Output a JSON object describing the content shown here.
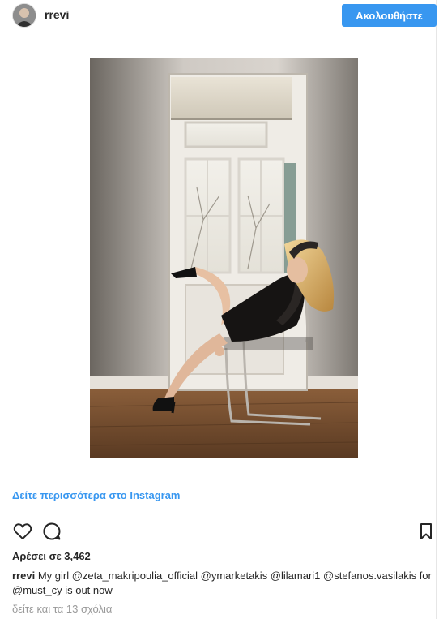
{
  "post": {
    "username": "rrevi",
    "follow_label": "Ακολουθήστε",
    "see_more": "Δείτε περισσότερα στο Instagram",
    "likes_text": "Αρέσει σε 3,462",
    "caption_user": "rrevi",
    "caption_text": "My girl @zeta_makripoulia_official @ymarketakis @lilamari1 @stefanos.vasilakis for @must_cy is out now",
    "view_comments": "δείτε και τα 13 σχόλια"
  },
  "colors": {
    "accent": "#3897f0",
    "text": "#262626",
    "muted": "#999999",
    "border": "#efefef"
  },
  "icons": {
    "like": "heart-outline-icon",
    "comment": "speech-bubble-icon",
    "save": "bookmark-icon"
  }
}
